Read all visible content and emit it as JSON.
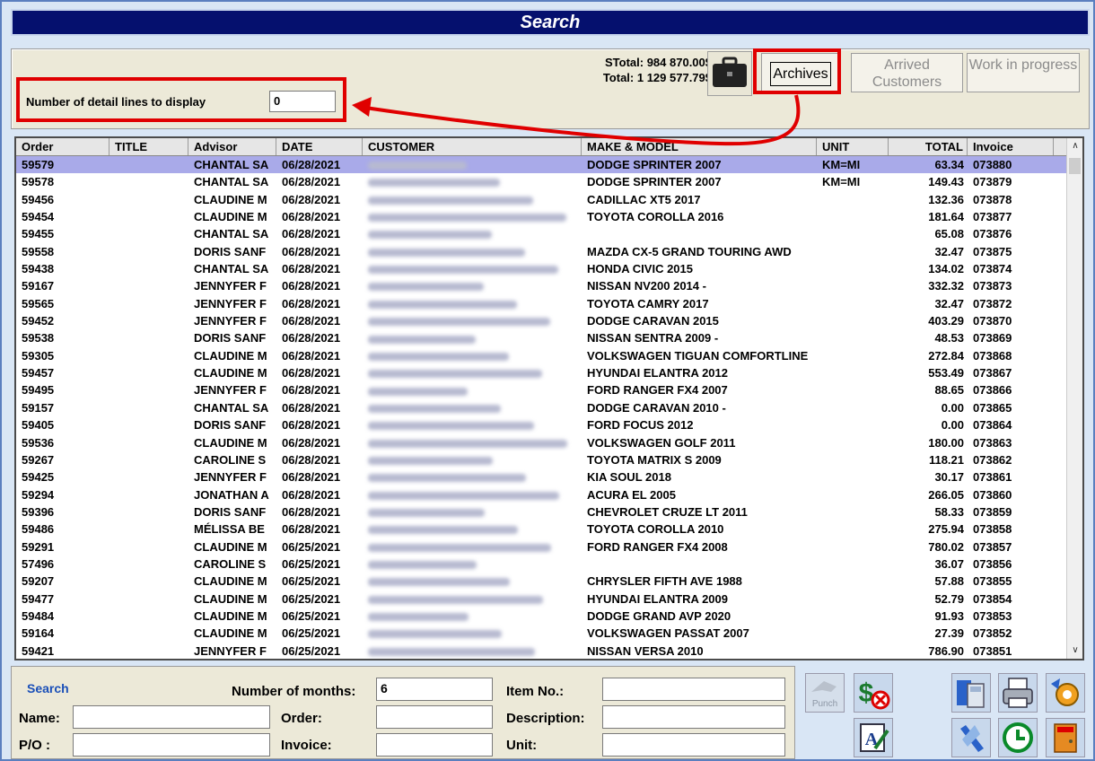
{
  "window": {
    "title": "Search"
  },
  "totals": {
    "stotal": "STotal: 984 870.00$",
    "total": "Total:  1 129 577.79$"
  },
  "toolbar": {
    "archives": "Archives",
    "arrived": "Arrived Customers",
    "work_in_progress": "Work in progress"
  },
  "detail": {
    "label": "Number of detail lines to display",
    "value": "0"
  },
  "columns": [
    "Order",
    "TITLE",
    "Advisor",
    "DATE",
    "CUSTOMER",
    "MAKE & MODEL",
    "UNIT",
    "TOTAL",
    "Invoice"
  ],
  "rows": [
    {
      "order": "59579",
      "advisor": "CHANTAL SA",
      "date": "06/28/2021",
      "make": "DODGE SPRINTER 2007",
      "unit": "KM=MI",
      "total": "63.34",
      "invoice": "073880"
    },
    {
      "order": "59578",
      "advisor": "CHANTAL SA",
      "date": "06/28/2021",
      "make": "DODGE SPRINTER 2007",
      "unit": "KM=MI",
      "total": "149.43",
      "invoice": "073879"
    },
    {
      "order": "59456",
      "advisor": "CLAUDINE M",
      "date": "06/28/2021",
      "make": "CADILLAC XT5 2017",
      "unit": "",
      "total": "132.36",
      "invoice": "073878"
    },
    {
      "order": "59454",
      "advisor": "CLAUDINE M",
      "date": "06/28/2021",
      "make": "TOYOTA COROLLA 2016",
      "unit": "",
      "total": "181.64",
      "invoice": "073877"
    },
    {
      "order": "59455",
      "advisor": "CHANTAL SA",
      "date": "06/28/2021",
      "make": "",
      "unit": "",
      "total": "65.08",
      "invoice": "073876"
    },
    {
      "order": "59558",
      "advisor": "DORIS SANF",
      "date": "06/28/2021",
      "make": "MAZDA CX-5 GRAND TOURING AWD",
      "unit": "",
      "total": "32.47",
      "invoice": "073875"
    },
    {
      "order": "59438",
      "advisor": "CHANTAL SA",
      "date": "06/28/2021",
      "make": "HONDA CIVIC 2015",
      "unit": "",
      "total": "134.02",
      "invoice": "073874"
    },
    {
      "order": "59167",
      "advisor": "JENNYFER F",
      "date": "06/28/2021",
      "make": "NISSAN NV200 2014 -",
      "unit": "",
      "total": "332.32",
      "invoice": "073873"
    },
    {
      "order": "59565",
      "advisor": "JENNYFER F",
      "date": "06/28/2021",
      "make": "TOYOTA CAMRY 2017",
      "unit": "",
      "total": "32.47",
      "invoice": "073872"
    },
    {
      "order": "59452",
      "advisor": "JENNYFER F",
      "date": "06/28/2021",
      "make": "DODGE CARAVAN 2015",
      "unit": "",
      "total": "403.29",
      "invoice": "073870"
    },
    {
      "order": "59538",
      "advisor": "DORIS SANF",
      "date": "06/28/2021",
      "make": "NISSAN SENTRA 2009 -",
      "unit": "",
      "total": "48.53",
      "invoice": "073869"
    },
    {
      "order": "59305",
      "advisor": "CLAUDINE M",
      "date": "06/28/2021",
      "make": "VOLKSWAGEN TIGUAN COMFORTLINE",
      "unit": "",
      "total": "272.84",
      "invoice": "073868"
    },
    {
      "order": "59457",
      "advisor": "CLAUDINE M",
      "date": "06/28/2021",
      "make": "HYUNDAI ELANTRA 2012",
      "unit": "",
      "total": "553.49",
      "invoice": "073867"
    },
    {
      "order": "59495",
      "advisor": "JENNYFER F",
      "date": "06/28/2021",
      "make": "FORD RANGER FX4 2007",
      "unit": "",
      "total": "88.65",
      "invoice": "073866"
    },
    {
      "order": "59157",
      "advisor": "CHANTAL SA",
      "date": "06/28/2021",
      "make": "DODGE CARAVAN 2010 -",
      "unit": "",
      "total": "0.00",
      "invoice": "073865"
    },
    {
      "order": "59405",
      "advisor": "DORIS SANF",
      "date": "06/28/2021",
      "make": "FORD FOCUS 2012",
      "unit": "",
      "total": "0.00",
      "invoice": "073864"
    },
    {
      "order": "59536",
      "advisor": "CLAUDINE M",
      "date": "06/28/2021",
      "make": "VOLKSWAGEN GOLF 2011",
      "unit": "",
      "total": "180.00",
      "invoice": "073863"
    },
    {
      "order": "59267",
      "advisor": "CAROLINE S",
      "date": "06/28/2021",
      "make": "TOYOTA MATRIX S 2009",
      "unit": "",
      "total": "118.21",
      "invoice": "073862"
    },
    {
      "order": "59425",
      "advisor": "JENNYFER F",
      "date": "06/28/2021",
      "make": "KIA SOUL 2018",
      "unit": "",
      "total": "30.17",
      "invoice": "073861"
    },
    {
      "order": "59294",
      "advisor": "JONATHAN A",
      "date": "06/28/2021",
      "make": "ACURA EL 2005",
      "unit": "",
      "total": "266.05",
      "invoice": "073860"
    },
    {
      "order": "59396",
      "advisor": "DORIS SANF",
      "date": "06/28/2021",
      "make": "CHEVROLET CRUZE LT 2011",
      "unit": "",
      "total": "58.33",
      "invoice": "073859"
    },
    {
      "order": "59486",
      "advisor": "MÉLISSA BE",
      "date": "06/28/2021",
      "make": "TOYOTA COROLLA 2010",
      "unit": "",
      "total": "275.94",
      "invoice": "073858"
    },
    {
      "order": "59291",
      "advisor": "CLAUDINE M",
      "date": "06/25/2021",
      "make": "FORD RANGER FX4 2008",
      "unit": "",
      "total": "780.02",
      "invoice": "073857"
    },
    {
      "order": "57496",
      "advisor": "CAROLINE S",
      "date": "06/25/2021",
      "make": "",
      "unit": "",
      "total": "36.07",
      "invoice": "073856"
    },
    {
      "order": "59207",
      "advisor": "CLAUDINE M",
      "date": "06/25/2021",
      "make": "CHRYSLER FIFTH AVE 1988",
      "unit": "",
      "total": "57.88",
      "invoice": "073855"
    },
    {
      "order": "59477",
      "advisor": "CLAUDINE M",
      "date": "06/25/2021",
      "make": "HYUNDAI ELANTRA 2009",
      "unit": "",
      "total": "52.79",
      "invoice": "073854"
    },
    {
      "order": "59484",
      "advisor": "CLAUDINE M",
      "date": "06/25/2021",
      "make": "DODGE GRAND AVP 2020",
      "unit": "",
      "total": "91.93",
      "invoice": "073853"
    },
    {
      "order": "59164",
      "advisor": "CLAUDINE M",
      "date": "06/25/2021",
      "make": "VOLKSWAGEN PASSAT 2007",
      "unit": "",
      "total": "27.39",
      "invoice": "073852"
    },
    {
      "order": "59421",
      "advisor": "JENNYFER F",
      "date": "06/25/2021",
      "make": "NISSAN VERSA 2010",
      "unit": "",
      "total": "786.90",
      "invoice": "073851"
    }
  ],
  "search": {
    "heading": "Search",
    "name_label": "Name:",
    "po_label": "P/O :",
    "months_label": "Number of months:",
    "months_value": "6",
    "order_label": "Order:",
    "invoice_label": "Invoice:",
    "item_label": "Item No.:",
    "description_label": "Description:",
    "unit_label": "Unit:"
  },
  "icons": {
    "punch_label": "Punch"
  },
  "colors": {
    "title_bg": "#05106e",
    "selected_row": "#a9aae9",
    "highlight": "#e00000"
  }
}
